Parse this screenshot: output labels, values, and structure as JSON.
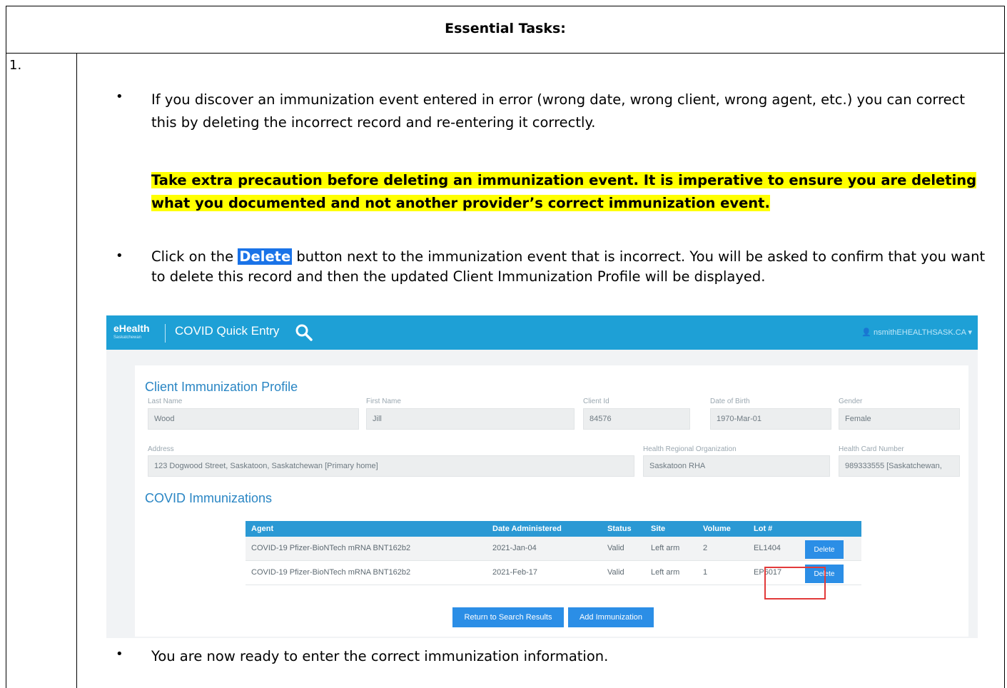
{
  "document": {
    "header": "Essential Tasks:",
    "row_number": "1.",
    "bullet_1": "If you discover an immunization event entered in error (wrong date, wrong client, wrong agent, etc.) you can correct this by deleting the incorrect record and re-entering it correctly.",
    "warning": "Take extra precaution before deleting an immunization event.  It is imperative to ensure you are deleting what you documented and not another provider’s correct immunization event.",
    "bullet_2_before": "Click on the ",
    "bullet_2_button": "Delete",
    "bullet_2_after": " button next to the immunization event that is incorrect. You will be asked to confirm that you want to delete this record and then the updated Client Immunization Profile will be displayed.",
    "bullet_3": "You are now ready to enter the correct immunization information.",
    "bullet_symbol": "•"
  },
  "screenshot": {
    "logo": "eHealth",
    "logo_sub": "Saskatchewan",
    "app_title": "COVID Quick Entry",
    "user": "👤 nsmithEHEALTHSASK.CA ▾",
    "profile_title": "Client Immunization Profile",
    "fields": {
      "last_name_label": "Last Name",
      "last_name": "Wood",
      "first_name_label": "First Name",
      "first_name": "Jill",
      "client_id_label": "Client Id",
      "client_id": "84576",
      "dob_label": "Date of Birth",
      "dob": "1970-Mar-01",
      "gender_label": "Gender",
      "gender": "Female",
      "address_label": "Address",
      "address": "123 Dogwood Street, Saskatoon, Saskatchewan  [Primary home]",
      "hro_label": "Health Regional Organization",
      "hro": "Saskatoon RHA",
      "hcn_label": "Health Card Number",
      "hcn": "989333555 [Saskatchewan,"
    },
    "immunizations_title": "COVID Immunizations",
    "columns": [
      "Agent",
      "Date Administered",
      "Status",
      "Site",
      "Volume",
      "Lot #"
    ],
    "rows": [
      {
        "agent": "COVID-19 Pfizer-BioNTech mRNA BNT162b2",
        "date": "2021-Jan-04",
        "status": "Valid",
        "site": "Left arm",
        "volume": "2",
        "lot": "EL1404",
        "action": "Delete"
      },
      {
        "agent": "COVID-19 Pfizer-BioNTech mRNA BNT162b2",
        "date": "2021-Feb-17",
        "status": "Valid",
        "site": "Left arm",
        "volume": "1",
        "lot": "EP6017",
        "action": "Delete"
      }
    ],
    "return_button": "Return to Search Results",
    "add_button": "Add Immunization"
  },
  "colors": {
    "highlight": "#ffff00",
    "appbar": "#1ea0d6",
    "accent": "#2b8ee6",
    "selection_box": "#e23a3a"
  }
}
